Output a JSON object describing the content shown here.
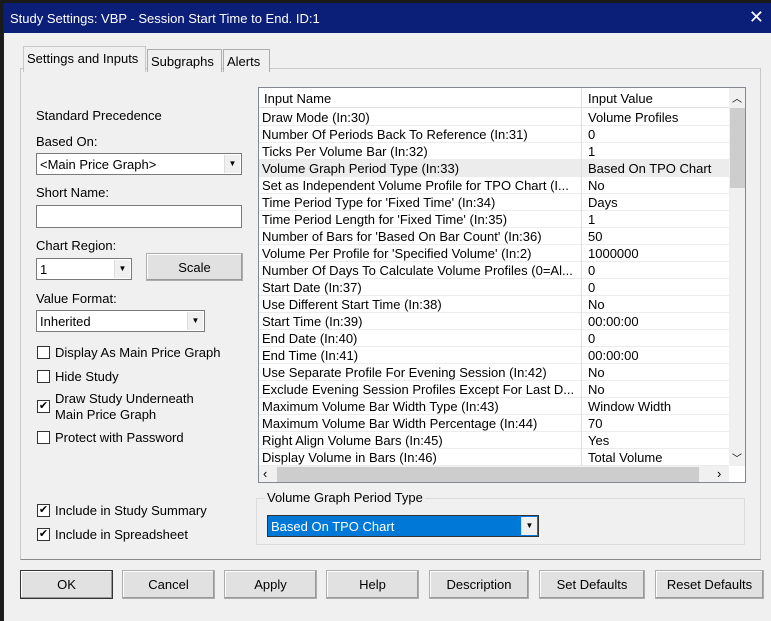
{
  "window": {
    "title": "Study Settings: VBP - Session Start Time to End. ID:1",
    "close_icon": "close-icon"
  },
  "tabs": [
    {
      "label": "Settings and Inputs",
      "active": true
    },
    {
      "label": "Subgraphs"
    },
    {
      "label": "Alerts"
    }
  ],
  "left": {
    "standard_precedence": "Standard Precedence",
    "based_on_label": "Based On:",
    "based_on_value": "<Main Price Graph>",
    "short_name_label": "Short Name:",
    "short_name_value": "",
    "chart_region_label": "Chart Region:",
    "chart_region_value": "1",
    "scale_button": "Scale",
    "value_format_label": "Value Format:",
    "value_format_value": "Inherited",
    "checkboxes": [
      {
        "label": "Display As Main Price Graph",
        "checked": false
      },
      {
        "label": "Hide Study",
        "checked": false
      },
      {
        "label": "Draw Study Underneath",
        "label2": "Main Price Graph",
        "checked": true
      },
      {
        "label": "Protect with Password",
        "checked": false
      },
      {
        "label": "Include in Study Summary",
        "checked": true
      },
      {
        "label": "Include in Spreadsheet",
        "checked": true
      }
    ]
  },
  "grid": {
    "headers": [
      "Input Name",
      "Input Value"
    ],
    "selected_index": 3,
    "rows": [
      {
        "name": "Draw Mode   (In:30)",
        "value": "Volume Profiles"
      },
      {
        "name": "Number Of Periods Back To Reference   (In:31)",
        "value": "0"
      },
      {
        "name": "Ticks Per Volume Bar   (In:32)",
        "value": "1"
      },
      {
        "name": "Volume Graph Period Type   (In:33)",
        "value": "Based On TPO Chart"
      },
      {
        "name": "Set as Independent Volume Profile for TPO Chart   (I...",
        "value": "No"
      },
      {
        "name": "Time Period Type for 'Fixed Time'   (In:34)",
        "value": "Days"
      },
      {
        "name": "Time Period Length for 'Fixed Time'   (In:35)",
        "value": "1"
      },
      {
        "name": "Number of Bars for 'Based On Bar Count'   (In:36)",
        "value": "50"
      },
      {
        "name": "Volume Per Profile for 'Specified Volume'   (In:2)",
        "value": "1000000"
      },
      {
        "name": "Number Of Days To Calculate Volume Profiles (0=Al...",
        "value": "0"
      },
      {
        "name": "Start Date   (In:37)",
        "value": "0"
      },
      {
        "name": "Use Different Start Time   (In:38)",
        "value": "No"
      },
      {
        "name": "Start Time   (In:39)",
        "value": "00:00:00"
      },
      {
        "name": "End Date   (In:40)",
        "value": "0"
      },
      {
        "name": "End Time   (In:41)",
        "value": "00:00:00"
      },
      {
        "name": "Use Separate Profile For Evening Session   (In:42)",
        "value": "No"
      },
      {
        "name": "Exclude Evening Session Profiles Except For Last D...",
        "value": "No"
      },
      {
        "name": "Maximum Volume Bar Width Type   (In:43)",
        "value": "Window Width"
      },
      {
        "name": "Maximum Volume Bar Width Percentage   (In:44)",
        "value": "70"
      },
      {
        "name": "Right Align Volume Bars   (In:45)",
        "value": "Yes"
      },
      {
        "name": "Display Volume in Bars   (In:46)",
        "value": "Total Volume"
      }
    ]
  },
  "editor": {
    "group_label": "Volume Graph Period Type",
    "value": "Based On TPO Chart",
    "accent": "#0078d7"
  },
  "buttons": [
    "OK",
    "Cancel",
    "Apply",
    "Help",
    "Description",
    "Set Defaults",
    "Reset Defaults"
  ]
}
